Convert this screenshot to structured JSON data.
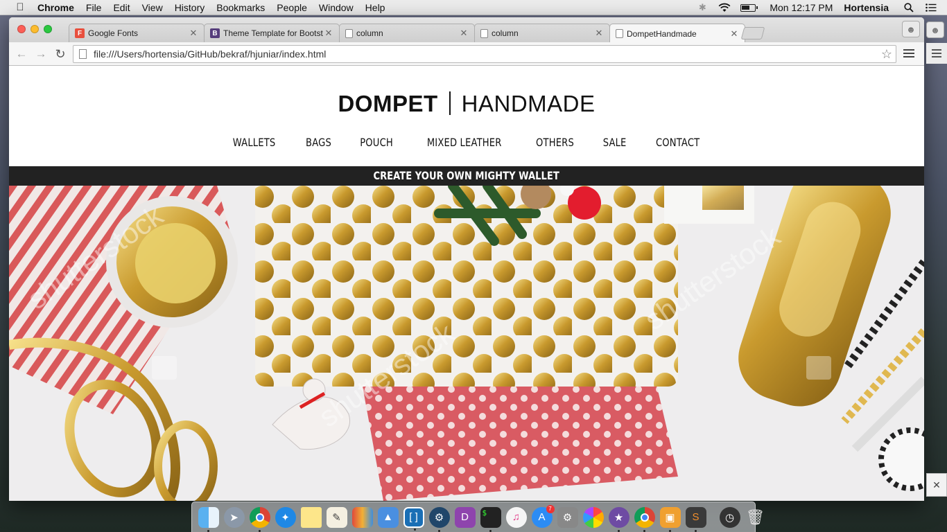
{
  "menubar": {
    "app": "Chrome",
    "items": [
      "File",
      "Edit",
      "View",
      "History",
      "Bookmarks",
      "People",
      "Window",
      "Help"
    ],
    "clock": "Mon 12:17 PM",
    "user": "Hortensia"
  },
  "tabs": [
    {
      "title": "Google Fonts",
      "favicon": "google-fonts-icon"
    },
    {
      "title": "Theme Template for Bootst",
      "favicon": "bootstrap-icon"
    },
    {
      "title": "column",
      "favicon": "document-icon"
    },
    {
      "title": "column",
      "favicon": "document-icon"
    },
    {
      "title": "DompetHandmade",
      "favicon": "document-icon",
      "active": true
    }
  ],
  "toolbar": {
    "url": "file:///Users/hortensia/GitHub/bekraf/hjuniar/index.html"
  },
  "site": {
    "logo_bold": "DOMPET",
    "logo_light": "HANDMADE",
    "nav": [
      "WALLETS",
      "BAGS",
      "POUCH",
      "MIXED LEATHER",
      "OTHERS",
      "SALE",
      "CONTACT"
    ],
    "banner": "CREATE YOUR OWN MIGHTY WALLET",
    "hero_watermark": "shutterstock"
  },
  "dock": {
    "apps": [
      "finder-icon",
      "launchpad-icon",
      "chrome-icon",
      "safari-icon",
      "notes-icon",
      "textedit-icon",
      "keynote-icon",
      "preview-icon",
      "brackets-icon",
      "sourcetree-icon",
      "dash-icon",
      "terminal-icon",
      "itunes-icon",
      "app-store-icon",
      "system-preferences-icon",
      "photos-icon",
      "github-icon",
      "chrome-canary-icon",
      "image-editor-icon",
      "sublime-text-icon"
    ],
    "appstore_badge": "7",
    "terminal_label": "$"
  }
}
